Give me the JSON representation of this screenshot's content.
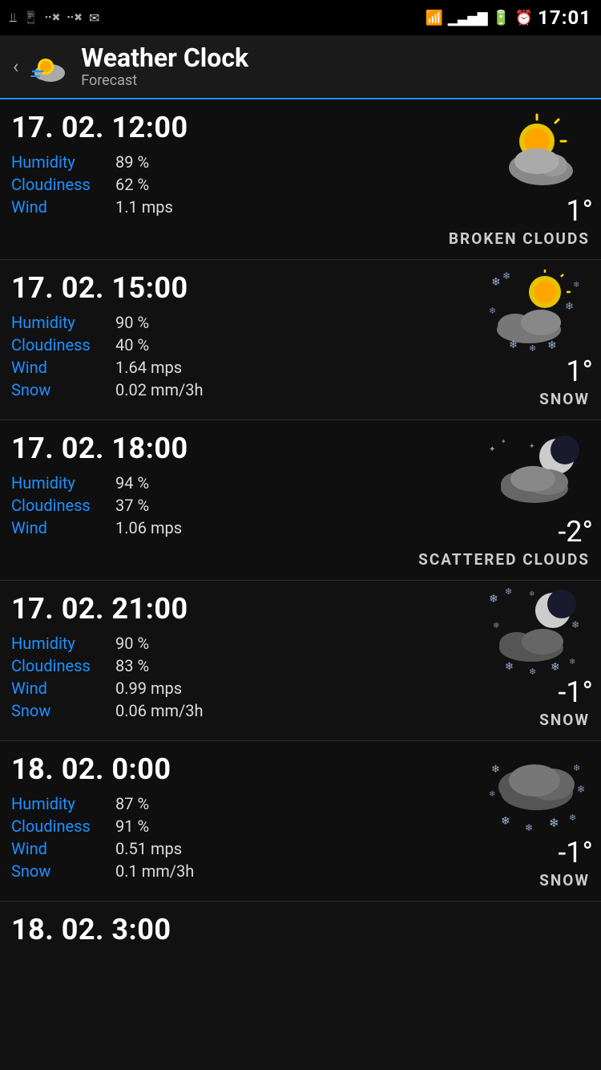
{
  "statusBar": {
    "time": "17:01",
    "icons": [
      "usb",
      "notification",
      "signal-x1",
      "signal-x2",
      "email",
      "wifi",
      "cell-signal",
      "battery",
      "alarm"
    ]
  },
  "header": {
    "title": "Weather Clock",
    "subtitle": "Forecast",
    "backLabel": "‹"
  },
  "forecasts": [
    {
      "id": "f1",
      "datetime": "17. 02. 12:00",
      "humidity": "89 %",
      "cloudiness": "62 %",
      "wind": "1.1 mps",
      "snow": null,
      "temp": "1°",
      "condition": "BROKEN CLOUDS",
      "iconType": "broken-clouds-sun"
    },
    {
      "id": "f2",
      "datetime": "17. 02. 15:00",
      "humidity": "90 %",
      "cloudiness": "40 %",
      "wind": "1.64 mps",
      "snow": "0.02 mm/3h",
      "temp": "1°",
      "condition": "SNOW",
      "iconType": "snow-sun"
    },
    {
      "id": "f3",
      "datetime": "17. 02. 18:00",
      "humidity": "94 %",
      "cloudiness": "37 %",
      "wind": "1.06 mps",
      "snow": null,
      "temp": "-2°",
      "condition": "SCATTERED CLOUDS",
      "iconType": "scattered-clouds-moon"
    },
    {
      "id": "f4",
      "datetime": "17. 02. 21:00",
      "humidity": "90 %",
      "cloudiness": "83 %",
      "wind": "0.99 mps",
      "snow": "0.06 mm/3h",
      "temp": "-1°",
      "condition": "SNOW",
      "iconType": "snow-moon"
    },
    {
      "id": "f5",
      "datetime": "18. 02. 0:00",
      "humidity": "87 %",
      "cloudiness": "91 %",
      "wind": "0.51 mps",
      "snow": "0.1 mm/3h",
      "temp": "-1°",
      "condition": "SNOW",
      "iconType": "snow-cloud"
    },
    {
      "id": "f6",
      "datetime": "18. 02. 3:00",
      "humidity": null,
      "cloudiness": null,
      "wind": null,
      "snow": null,
      "temp": null,
      "condition": "",
      "iconType": "snow-cloud"
    }
  ],
  "labels": {
    "humidity": "Humidity",
    "cloudiness": "Cloudiness",
    "wind": "Wind",
    "snow": "Snow"
  }
}
